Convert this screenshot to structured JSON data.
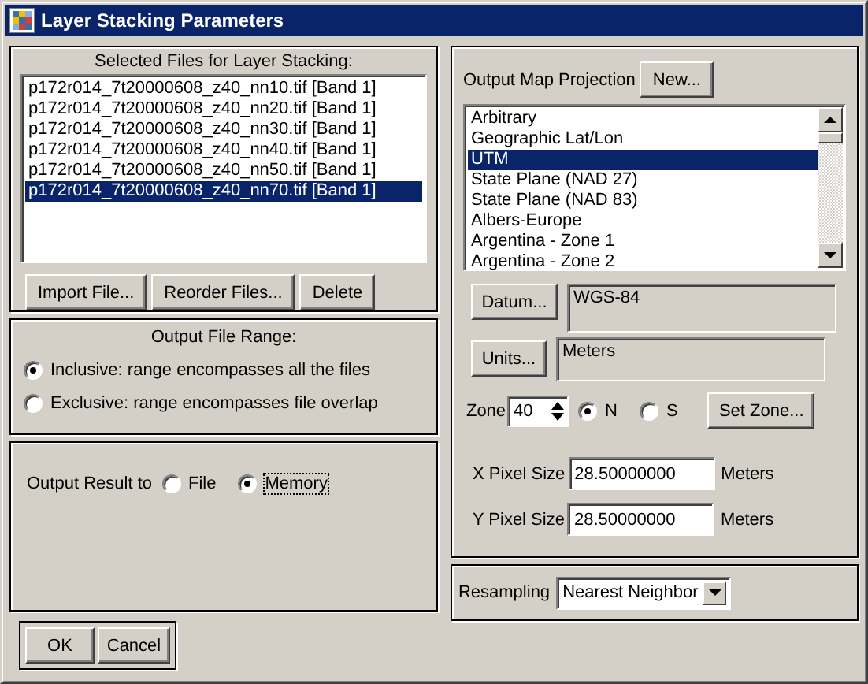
{
  "window": {
    "title": "Layer Stacking Parameters"
  },
  "files": {
    "label": "Selected Files for Layer Stacking:",
    "items": [
      {
        "text": "p172r014_7t20000608_z40_nn10.tif [Band 1]",
        "selected": false
      },
      {
        "text": "p172r014_7t20000608_z40_nn20.tif [Band 1]",
        "selected": false
      },
      {
        "text": "p172r014_7t20000608_z40_nn30.tif [Band 1]",
        "selected": false
      },
      {
        "text": "p172r014_7t20000608_z40_nn40.tif [Band 1]",
        "selected": false
      },
      {
        "text": "p172r014_7t20000608_z40_nn50.tif [Band 1]",
        "selected": false
      },
      {
        "text": "p172r014_7t20000608_z40_nn70.tif [Band 1]",
        "selected": true
      }
    ],
    "buttons": [
      "Import File...",
      "Reorder Files...",
      "Delete"
    ]
  },
  "output_file_range": {
    "label": "Output File Range:",
    "options": [
      {
        "label": "Inclusive: range encompasses all the files",
        "selected": true
      },
      {
        "label": "Exclusive: range encompasses file overlap",
        "selected": false
      }
    ]
  },
  "output_result": {
    "label": "Output Result to",
    "options": [
      {
        "label": "File",
        "selected": false,
        "focused": false
      },
      {
        "label": "Memory",
        "selected": true,
        "focused": true
      }
    ]
  },
  "projection": {
    "label": "Output Map Projection",
    "new_button": "New...",
    "items": [
      {
        "text": "Arbitrary",
        "selected": false
      },
      {
        "text": "Geographic Lat/Lon",
        "selected": false
      },
      {
        "text": "UTM",
        "selected": true
      },
      {
        "text": "State Plane (NAD 27)",
        "selected": false
      },
      {
        "text": "State Plane (NAD 83)",
        "selected": false
      },
      {
        "text": "Albers-Europe",
        "selected": false
      },
      {
        "text": "Argentina - Zone 1",
        "selected": false
      },
      {
        "text": "Argentina - Zone 2",
        "selected": false
      }
    ],
    "datum": {
      "button": "Datum...",
      "value": "WGS-84"
    },
    "units": {
      "button": "Units...",
      "value": "Meters"
    },
    "zone": {
      "label": "Zone",
      "value": "40",
      "hemispheres": [
        {
          "label": "N",
          "selected": true
        },
        {
          "label": "S",
          "selected": false
        }
      ],
      "button": "Set Zone..."
    },
    "pixel_sizes": [
      {
        "label": "X Pixel Size",
        "value": "28.50000000",
        "unit": "Meters"
      },
      {
        "label": "Y Pixel Size",
        "value": "28.50000000",
        "unit": "Meters"
      }
    ]
  },
  "resampling": {
    "label": "Resampling",
    "value": "Nearest Neighbor"
  },
  "buttons": [
    "OK",
    "Cancel"
  ]
}
